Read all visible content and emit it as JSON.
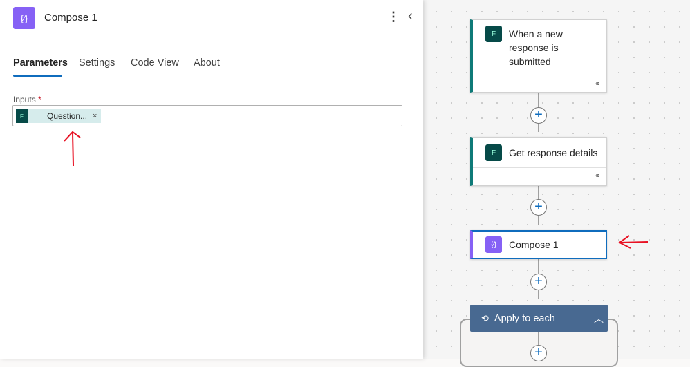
{
  "panel": {
    "title": "Compose 1",
    "icon": "compose-icon",
    "tabs": [
      {
        "label": "Parameters",
        "active": true
      },
      {
        "label": "Settings"
      },
      {
        "label": "Code View"
      },
      {
        "label": "About"
      }
    ],
    "inputs_label": "Inputs",
    "required_mark": "*",
    "token": {
      "label": "Question...",
      "remove": "×",
      "icon": "forms-icon"
    }
  },
  "canvas": {
    "trigger": {
      "label": "When a new response is submitted"
    },
    "action1": {
      "label": "Get response details"
    },
    "compose": {
      "label": "Compose 1"
    },
    "loop": {
      "label": "Apply to each"
    }
  },
  "colors": {
    "accent": "#0f6cbd",
    "compose": "#8661f5",
    "forms": "#0e7a78",
    "loop": "#486991",
    "annotation": "#e81123"
  }
}
